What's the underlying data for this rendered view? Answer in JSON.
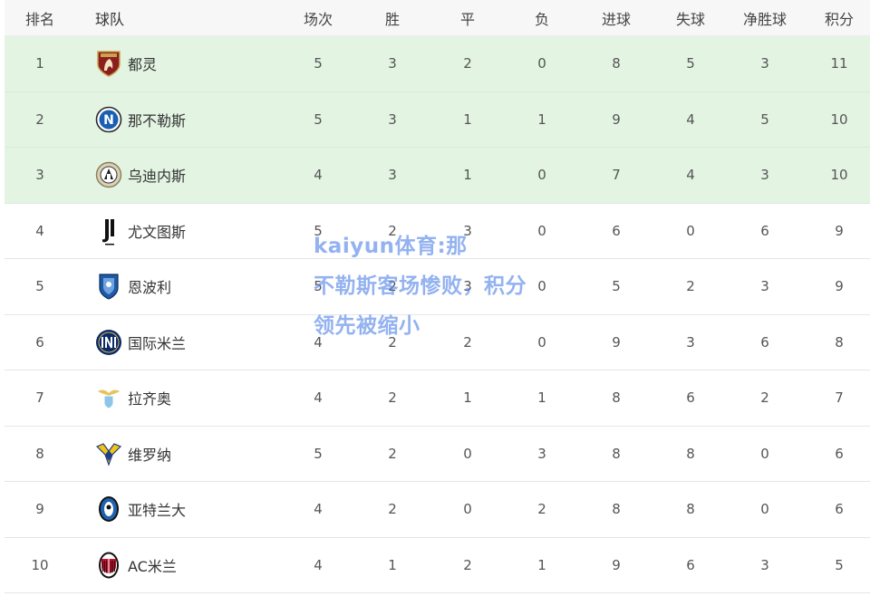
{
  "table": {
    "headers": {
      "rank": "排名",
      "team": "球队",
      "played": "场次",
      "won": "胜",
      "drawn": "平",
      "lost": "负",
      "goals_for": "进球",
      "goals_against": "失球",
      "goal_diff": "净胜球",
      "points": "积分"
    },
    "rows": [
      {
        "rank": "1",
        "team": "都灵",
        "logo": "torino-logo",
        "played": "5",
        "won": "3",
        "drawn": "2",
        "lost": "0",
        "gf": "8",
        "ga": "5",
        "gd": "3",
        "pts": "11"
      },
      {
        "rank": "2",
        "team": "那不勒斯",
        "logo": "napoli-logo",
        "played": "5",
        "won": "3",
        "drawn": "1",
        "lost": "1",
        "gf": "9",
        "ga": "4",
        "gd": "5",
        "pts": "10"
      },
      {
        "rank": "3",
        "team": "乌迪内斯",
        "logo": "udinese-logo",
        "played": "4",
        "won": "3",
        "drawn": "1",
        "lost": "0",
        "gf": "7",
        "ga": "4",
        "gd": "3",
        "pts": "10"
      },
      {
        "rank": "4",
        "team": "尤文图斯",
        "logo": "juventus-logo",
        "played": "5",
        "won": "2",
        "drawn": "3",
        "lost": "0",
        "gf": "6",
        "ga": "0",
        "gd": "6",
        "pts": "9"
      },
      {
        "rank": "5",
        "team": "恩波利",
        "logo": "empoli-logo",
        "played": "5",
        "won": "2",
        "drawn": "3",
        "lost": "0",
        "gf": "5",
        "ga": "2",
        "gd": "3",
        "pts": "9"
      },
      {
        "rank": "6",
        "team": "国际米兰",
        "logo": "inter-logo",
        "played": "4",
        "won": "2",
        "drawn": "2",
        "lost": "0",
        "gf": "9",
        "ga": "3",
        "gd": "6",
        "pts": "8"
      },
      {
        "rank": "7",
        "team": "拉齐奥",
        "logo": "lazio-logo",
        "played": "4",
        "won": "2",
        "drawn": "1",
        "lost": "1",
        "gf": "8",
        "ga": "6",
        "gd": "2",
        "pts": "7"
      },
      {
        "rank": "8",
        "team": "维罗纳",
        "logo": "verona-logo",
        "played": "5",
        "won": "2",
        "drawn": "0",
        "lost": "3",
        "gf": "8",
        "ga": "8",
        "gd": "0",
        "pts": "6"
      },
      {
        "rank": "9",
        "team": "亚特兰大",
        "logo": "atalanta-logo",
        "played": "4",
        "won": "2",
        "drawn": "0",
        "lost": "2",
        "gf": "8",
        "ga": "8",
        "gd": "0",
        "pts": "6"
      },
      {
        "rank": "10",
        "team": "AC米兰",
        "logo": "ac-milan-logo",
        "played": "4",
        "won": "1",
        "drawn": "2",
        "lost": "1",
        "gf": "9",
        "ga": "6",
        "gd": "3",
        "pts": "5"
      }
    ]
  },
  "overlay": {
    "lines": [
      "kaiyun体育:那",
      "不勒斯客场惨败，积分",
      "领先被缩小"
    ]
  },
  "colors": {
    "top_row_bg": "#e3f4e3",
    "header_bg": "#f7f7f7",
    "overlay_text": "#5082e6"
  }
}
